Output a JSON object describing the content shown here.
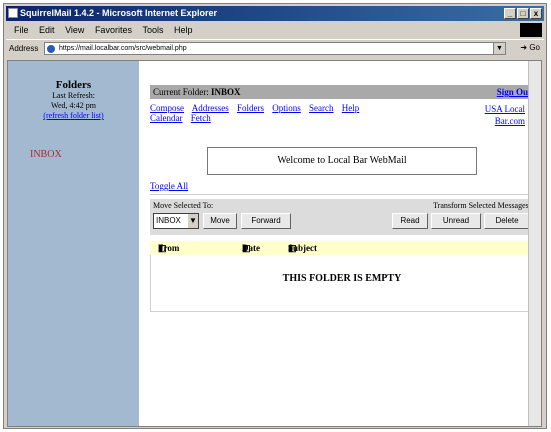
{
  "window": {
    "title": "SquirrelMail 1.4.2 - Microsoft Internet Explorer",
    "controls": [
      "_",
      "□",
      "x"
    ]
  },
  "menu": [
    "File",
    "Edit",
    "View",
    "Favorites",
    "Tools",
    "Help"
  ],
  "address": {
    "label": "Address",
    "url": "https://mail.localbar.com/src/webmail.php",
    "go_label": "Go"
  },
  "left": {
    "title": "Folders",
    "last_refresh_label": "Last Refresh:",
    "last_refresh_time": "Wed, 4:42 pm",
    "refresh_link": "(refresh folder list)",
    "inbox": "INBOX"
  },
  "main": {
    "current_folder_label": "Current Folder:",
    "current_folder": "INBOX",
    "sign_out": "Sign Out",
    "nav": [
      "Compose",
      "Addresses",
      "Folders",
      "Options",
      "Search",
      "Help",
      "Calendar",
      "Fetch"
    ],
    "right_links": [
      "USA Local",
      "Bar.com"
    ],
    "welcome": "Welcome to Local Bar WebMail",
    "toggle_all": "Toggle All",
    "move_selected_label": "Move Selected To:",
    "transform_label": "Transform Selected Messages:",
    "move_folder": "INBOX",
    "buttons": {
      "move": "Move",
      "forward": "Forward",
      "read": "Read",
      "unread": "Unread",
      "delete": "Delete"
    },
    "columns": [
      "From",
      "Date",
      "Subject"
    ],
    "empty": "THIS FOLDER IS EMPTY"
  }
}
